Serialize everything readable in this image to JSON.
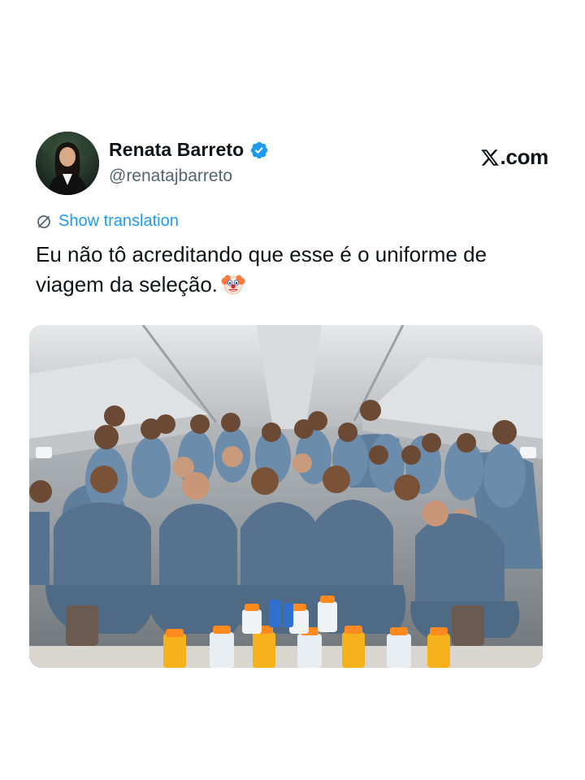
{
  "author": {
    "display_name": "Renata Barreto",
    "handle": "@renatajbarreto",
    "verified": true,
    "avatar_icon": "profile-photo"
  },
  "source": {
    "site": ".com",
    "logo_icon": "x-logo-icon"
  },
  "tweet": {
    "translate_label": "Show translation",
    "text": "Eu não tô acreditando que esse é o uniforme de viagem da seleção.",
    "emoji": "clown-face"
  },
  "colors": {
    "link": "#1d9bf0",
    "text": "#0f1419",
    "secondary": "#536471",
    "verified": "#1d9bf0",
    "uniform": "#5f7e9c"
  },
  "media": {
    "type": "photo",
    "subject": "team-photo"
  }
}
